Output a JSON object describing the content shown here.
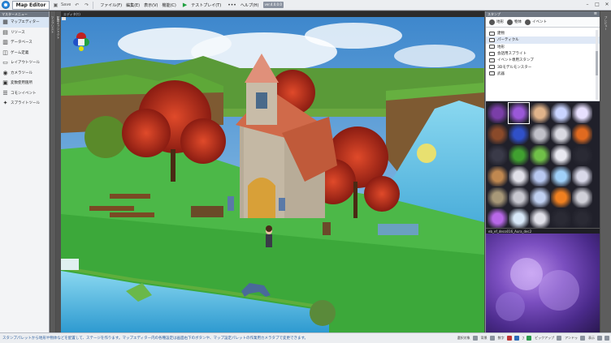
{
  "app": {
    "title": "Map Editor"
  },
  "toolbar": {
    "save": "Save",
    "menus": [
      "ファイル(F)",
      "編集(E)",
      "表示(V)",
      "機能(C)"
    ],
    "test_play": "テストプレイ(T)",
    "more": "•••",
    "help": "ヘルプ(H)",
    "version": "ver.4.0.0.0",
    "icons": [
      "app-icon",
      "save-icon",
      "undo-icon",
      "redo-icon",
      "play-icon"
    ]
  },
  "left_panel": {
    "header": "マスターメニュー",
    "items": [
      {
        "label": "マップエディター",
        "icon": "map-icon"
      },
      {
        "label": "リソース",
        "icon": "resource-icon"
      },
      {
        "label": "データベース",
        "icon": "database-icon"
      },
      {
        "label": "ゲーム定義",
        "icon": "gamepad-icon"
      },
      {
        "label": "レイアウトツール",
        "icon": "layout-icon"
      },
      {
        "label": "カメラツール",
        "icon": "camera-icon"
      },
      {
        "label": "変数使用箇所",
        "icon": "variable-icon"
      },
      {
        "label": "コモンイベント",
        "icon": "common-event-icon"
      },
      {
        "label": "スプライトツール",
        "icon": "sprite-icon"
      }
    ],
    "side_tabs": [
      "マップリスト",
      "配置オブジェクト",
      "プロパティ"
    ]
  },
  "viewport": {
    "tab_label": "エディタ(ﾜ)"
  },
  "stamp_panel": {
    "header": "スタンプ",
    "tabs": [
      {
        "label": "地形",
        "icon": "terrain-icon"
      },
      {
        "label": "物体",
        "icon": "object-icon"
      },
      {
        "label": "イベント",
        "icon": "event-icon"
      }
    ],
    "folders": [
      "建物",
      "パーティクル",
      "地形",
      "会話用スプライト",
      "イベント専用スタンプ",
      "3Dモデルモンスター",
      "武器"
    ],
    "selected_folder": 1,
    "preview_label": "eb_ef_deco016_Aura_dec2",
    "grid_colors": [
      "#7a3ea8",
      "#9a58d8",
      "#e0b38a",
      "#c9d4ff",
      "#e8e0ff",
      "#8a4a2a",
      "#3050c8",
      "#c0c0c8",
      "#d8d8e0",
      "#e06a20",
      "#3a3a48",
      "#40a030",
      "#70c048",
      "#e8e8f0",
      "#2a2a34",
      "#c08850",
      "#e0e0e8",
      "#b8c8f0",
      "#a0d0f8",
      "#d8d8e8",
      "#a89878",
      "#c8c8d0",
      "#c0d0f0",
      "#f08020",
      "#d0d0d8",
      "#b868e8",
      "#d8e8f8",
      "#e0e0e8",
      "#2a2a34",
      "#2a2a34"
    ],
    "side_tab": "プレビュー"
  },
  "status": {
    "message": "スタンプパレットから地形や物体などを配置して、ステージを作ります。マップエディター内の各種設定は画面右下のボタンや、マップ設定パレットの作業用カメラタブで変更できます。",
    "right": [
      "選択対象",
      "背景",
      "数字",
      "7",
      "カメラ",
      "ピックアップ",
      "アクター",
      "アンドゥ",
      "表示"
    ]
  }
}
